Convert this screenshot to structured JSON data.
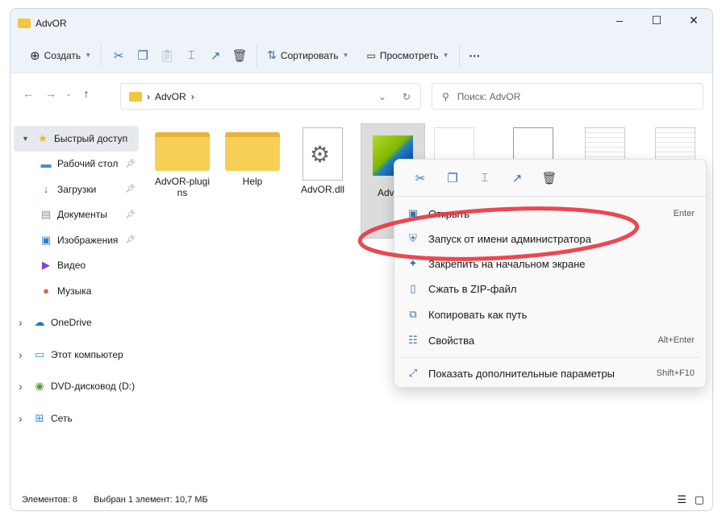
{
  "window": {
    "title": "AdvOR",
    "minimize": "–",
    "maximize": "☐",
    "close": "✕"
  },
  "toolbar": {
    "create": "Создать",
    "sort": "Сортировать",
    "view": "Просмотреть",
    "more": "···"
  },
  "address": {
    "path": "AdvOR",
    "search_placeholder": "Поиск: AdvOR"
  },
  "sidebar": {
    "items": [
      {
        "label": "Быстрый доступ",
        "icon": "star-icon",
        "color": "#f2b01e"
      },
      {
        "label": "Рабочий стол",
        "icon": "desktop-icon",
        "color": "#3b8ede",
        "pinned": true
      },
      {
        "label": "Загрузки",
        "icon": "download-icon",
        "color": "#1f8a5a",
        "pinned": true
      },
      {
        "label": "Документы",
        "icon": "documents-icon",
        "color": "#8a93a0",
        "pinned": true
      },
      {
        "label": "Изображения",
        "icon": "pictures-icon",
        "color": "#2d7fd6",
        "pinned": true
      },
      {
        "label": "Видео",
        "icon": "video-icon",
        "color": "#8a3fd1"
      },
      {
        "label": "Музыка",
        "icon": "music-icon",
        "color": "#e0643a"
      },
      {
        "label": "OneDrive",
        "icon": "cloud-icon",
        "color": "#1b75d0"
      },
      {
        "label": "Этот компьютер",
        "icon": "computer-icon",
        "color": "#2b8fd8"
      },
      {
        "label": "DVD-дисковод (D:)",
        "icon": "dvd-icon",
        "color": "#5a9a3a"
      },
      {
        "label": "Сеть",
        "icon": "network-icon",
        "color": "#2b8fd8"
      }
    ]
  },
  "files": [
    {
      "name": "AdvOR-plugins",
      "type": "folder"
    },
    {
      "name": "Help",
      "type": "folder"
    },
    {
      "name": "AdvOR.dll",
      "type": "dll"
    },
    {
      "name": "Adv",
      "type": "exe"
    }
  ],
  "context_menu": {
    "items": [
      {
        "label": "Открыть",
        "shortcut": "Enter",
        "icon": "open-icon"
      },
      {
        "label": "Запуск от имени администратора",
        "shortcut": "",
        "icon": "shield-icon"
      },
      {
        "label": "Закрепить на начальном экране",
        "shortcut": "",
        "icon": "pin-icon"
      },
      {
        "label": "Сжать в ZIP-файл",
        "shortcut": "",
        "icon": "zip-icon"
      },
      {
        "label": "Копировать как путь",
        "shortcut": "",
        "icon": "path-icon"
      },
      {
        "label": "Свойства",
        "shortcut": "Alt+Enter",
        "icon": "properties-icon"
      },
      {
        "label": "Показать дополнительные параметры",
        "shortcut": "Shift+F10",
        "icon": "more-options-icon"
      }
    ],
    "highlight_color": "#e8343f"
  },
  "status": {
    "count": "Элементов: 8",
    "selected": "Выбран 1 элемент: 10,7 МБ"
  }
}
